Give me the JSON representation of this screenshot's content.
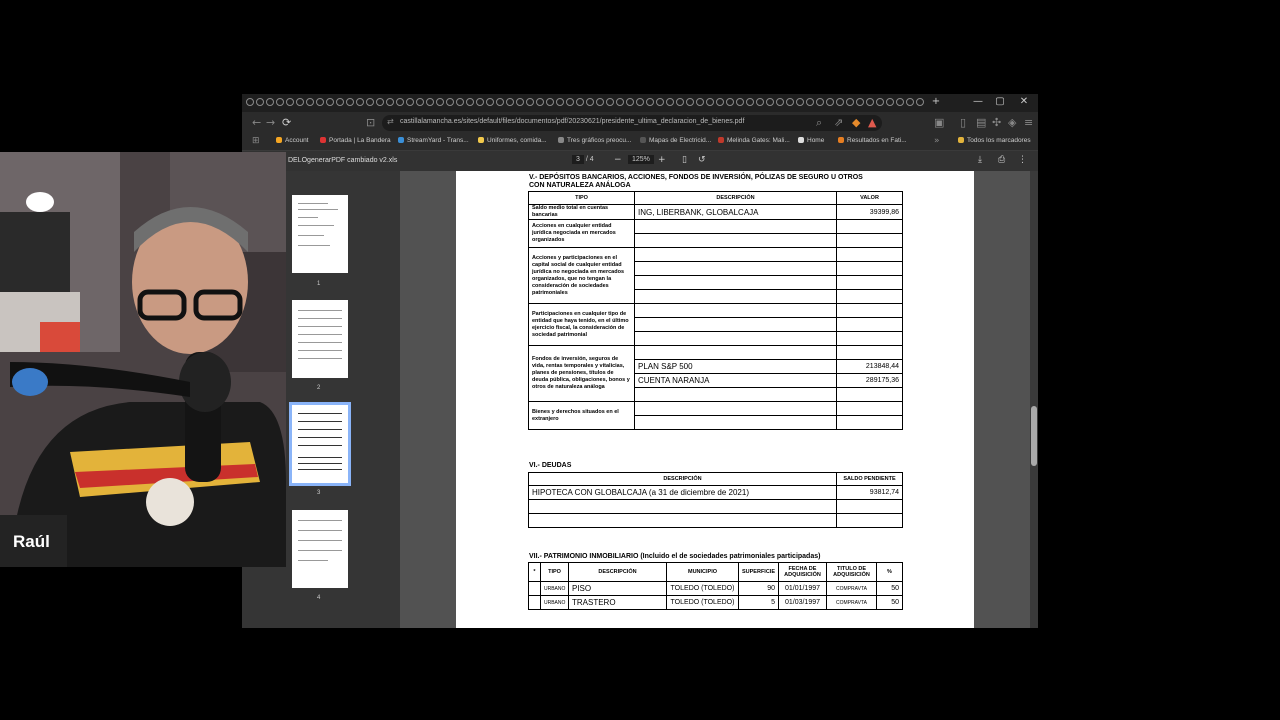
{
  "browser": {
    "url": "castillalamancha.es/sites/default/files/documentos/pdf/20230621/presidente_ultima_declaracion_de_bienes.pdf",
    "bookmarks": [
      "Account",
      "Portada | La Bandera",
      "StreamYard - Trans...",
      "Uniformes, comida...",
      "Tres gráficos preocu...",
      "Mapas de Electricid...",
      "Melinda Gates: Mali...",
      "Home",
      "Resultados en Fati..."
    ],
    "bookmarks_folder": "Todos los marcadores",
    "window_controls": {
      "minimize": "—",
      "maximize": "▢",
      "close": "✕"
    },
    "new_tab": "+"
  },
  "pdf_toolbar": {
    "title": "DELOgenerarPDF cambiado v2.xls",
    "page_current": "3",
    "page_separator": "/",
    "page_total": "4",
    "zoom": "125%"
  },
  "thumbnails": [
    {
      "label": "1"
    },
    {
      "label": "2"
    },
    {
      "label": "3",
      "selected": true
    },
    {
      "label": "4"
    }
  ],
  "document": {
    "section_v_title": "V.- DEPÓSITOS BANCARIOS, ACCIONES, FONDOS DE INVERSIÓN, PÓLIZAS DE SEGURO U OTROS",
    "section_v_title2": "CON NATURALEZA ANÁLOGA",
    "section_v_headers": {
      "tipo": "TIPO",
      "descripcion": "DESCRIPCIÓN",
      "valor": "VALOR"
    },
    "section_v_rows": [
      {
        "tipo": "Saldo medio total en cuentas bancarias",
        "items": [
          {
            "descripcion": "ING, LIBERBANK, GLOBALCAJA",
            "valor": "39399,86"
          }
        ]
      },
      {
        "tipo": "Acciones en cualquier entidad jurídica negociada en mercados organizados",
        "items": []
      },
      {
        "tipo": "Acciones y participaciones en el capital social de cualquier entidad jurídica no negociada en mercados organizados, que no tengan la consideración de sociedades patrimoniales",
        "items": []
      },
      {
        "tipo": "Participaciones en cualquier tipo de entidad que haya tenido, en el último ejercicio fiscal, la consideración de sociedad patrimonial",
        "items": []
      },
      {
        "tipo": "Fondos de inversión, seguros de vida, rentas temporales y vitalicias, planes de pensiones, títulos de deuda pública, obligaciones, bonos y otros de naturaleza análoga",
        "items": [
          {
            "descripcion": "PLAN S&P 500",
            "valor": "213848,44"
          },
          {
            "descripcion": "CUENTA NARANJA",
            "valor": "289175,36"
          }
        ]
      },
      {
        "tipo": "Bienes y derechos situados en el extranjero",
        "items": []
      }
    ],
    "section_vi_title": "VI.- DEUDAS",
    "section_vi_headers": {
      "descripcion": "DESCRIPCIÓN",
      "saldo": "SALDO PENDIENTE"
    },
    "section_vi_rows": [
      {
        "descripcion": "HIPOTECA CON GLOBALCAJA (a 31 de diciembre de 2021)",
        "saldo": "93812,74"
      }
    ],
    "section_vii_title": "VII.- PATRIMONIO INMOBILIARIO (Incluido el de sociedades patrimoniales participadas)",
    "section_vii_headers": {
      "n": "*",
      "tipo": "TIPO",
      "descripcion": "DESCRIPCIÓN",
      "municipio": "MUNICIPIO",
      "superficie": "SUPERFICIE",
      "fecha": "FECHA DE ADQUISICIÓN",
      "titulo": "TITULO DE ADQUISICIÓN",
      "pct": "%"
    },
    "section_vii_rows": [
      {
        "tipo": "URBANO",
        "descripcion": "PISO",
        "municipio": "TOLEDO (TOLEDO)",
        "superficie": "90",
        "fecha": "01/01/1997",
        "titulo": "COMPRAVTA",
        "pct": "50"
      },
      {
        "tipo": "URBANO",
        "descripcion": "TRASTERO",
        "municipio": "TOLEDO (TOLEDO)",
        "superficie": "5",
        "fecha": "01/03/1997",
        "titulo": "COMPRAVTA",
        "pct": "50"
      }
    ]
  },
  "webcam": {
    "name": "Raúl"
  },
  "colors": {
    "accent": "#8ab4f8",
    "toolbar": "#323232",
    "viewer_bg": "#525252"
  }
}
